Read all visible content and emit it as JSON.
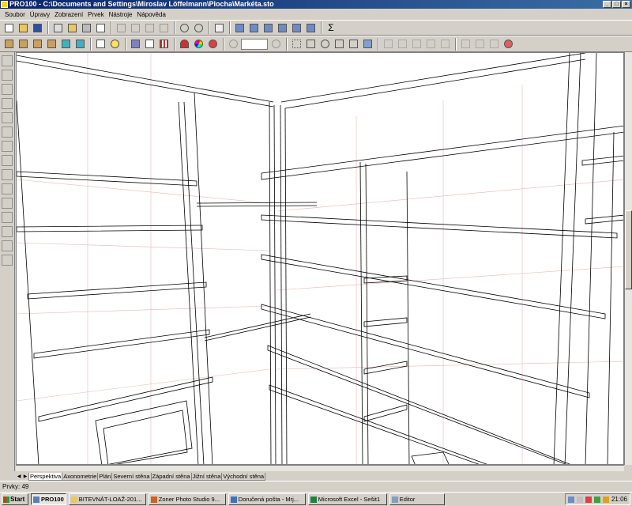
{
  "window": {
    "title": "PRO100 - C:\\Documents and Settings\\Miroslav Löffelmann\\Plocha\\Markéta.sto",
    "buttons": [
      "_",
      "□",
      "×"
    ]
  },
  "menu": [
    "Soubor",
    "Úpravy",
    "Zobrazení",
    "Prvek",
    "Nástroje",
    "Nápověda"
  ],
  "views": {
    "tabs": [
      "Perspektiva",
      "Axonometrie",
      "Plán",
      "Severní stěna",
      "Západní stěna",
      "Jižní stěna",
      "Východní stěna"
    ],
    "active_index": 0
  },
  "status": {
    "text": "Prvky: 49"
  },
  "taskbar": {
    "start_label": "Start",
    "pinned_label": "PRO100",
    "tasks": [
      {
        "label": "BITEVNÁT-LOAŽ-201...",
        "active": false
      },
      {
        "label": "Zoner Photo Studio 9...",
        "active": false
      },
      {
        "label": "Doručená pošta - Mrj...",
        "active": false
      },
      {
        "label": "Microsoft Excel - Sešit1",
        "active": false
      },
      {
        "label": "Editor",
        "active": false
      }
    ],
    "clock": "21:06"
  },
  "colors": {
    "titlebar": "#0a246a",
    "wire": "#000000",
    "grid": "#e6b8b8",
    "viewport_bg": "#ffffff"
  }
}
